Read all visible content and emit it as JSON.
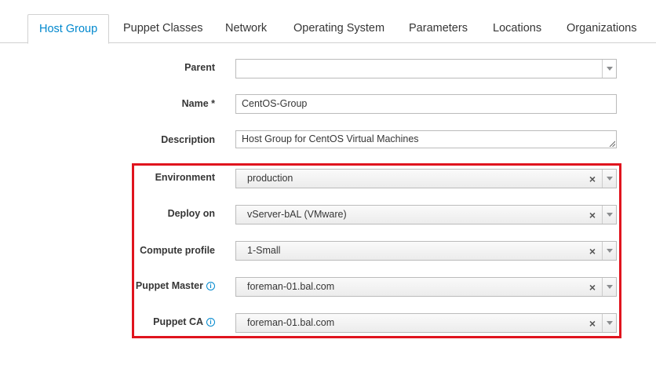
{
  "tabs": [
    {
      "label": "Host Group",
      "active": true
    },
    {
      "label": "Puppet Classes"
    },
    {
      "label": "Network"
    },
    {
      "label": "Operating System"
    },
    {
      "label": "Parameters"
    },
    {
      "label": "Locations"
    },
    {
      "label": "Organizations"
    }
  ],
  "form": {
    "parent": {
      "label": "Parent",
      "value": ""
    },
    "name": {
      "label": "Name *",
      "value": "CentOS-Group"
    },
    "description": {
      "label": "Description",
      "value": "Host Group for CentOS Virtual Machines"
    },
    "environment": {
      "label": "Environment",
      "value": "production"
    },
    "deploy_on": {
      "label": "Deploy on",
      "value": "vServer-bAL (VMware)"
    },
    "compute_profile": {
      "label": "Compute profile",
      "value": "1-Small"
    },
    "puppet_master": {
      "label": "Puppet Master",
      "value": "foreman-01.bal.com"
    },
    "puppet_ca": {
      "label": "Puppet CA",
      "value": "foreman-01.bal.com"
    }
  },
  "icons": {
    "info": "i",
    "clear": "×"
  },
  "colors": {
    "accent": "#0088ce",
    "highlight": "#e0141e"
  }
}
